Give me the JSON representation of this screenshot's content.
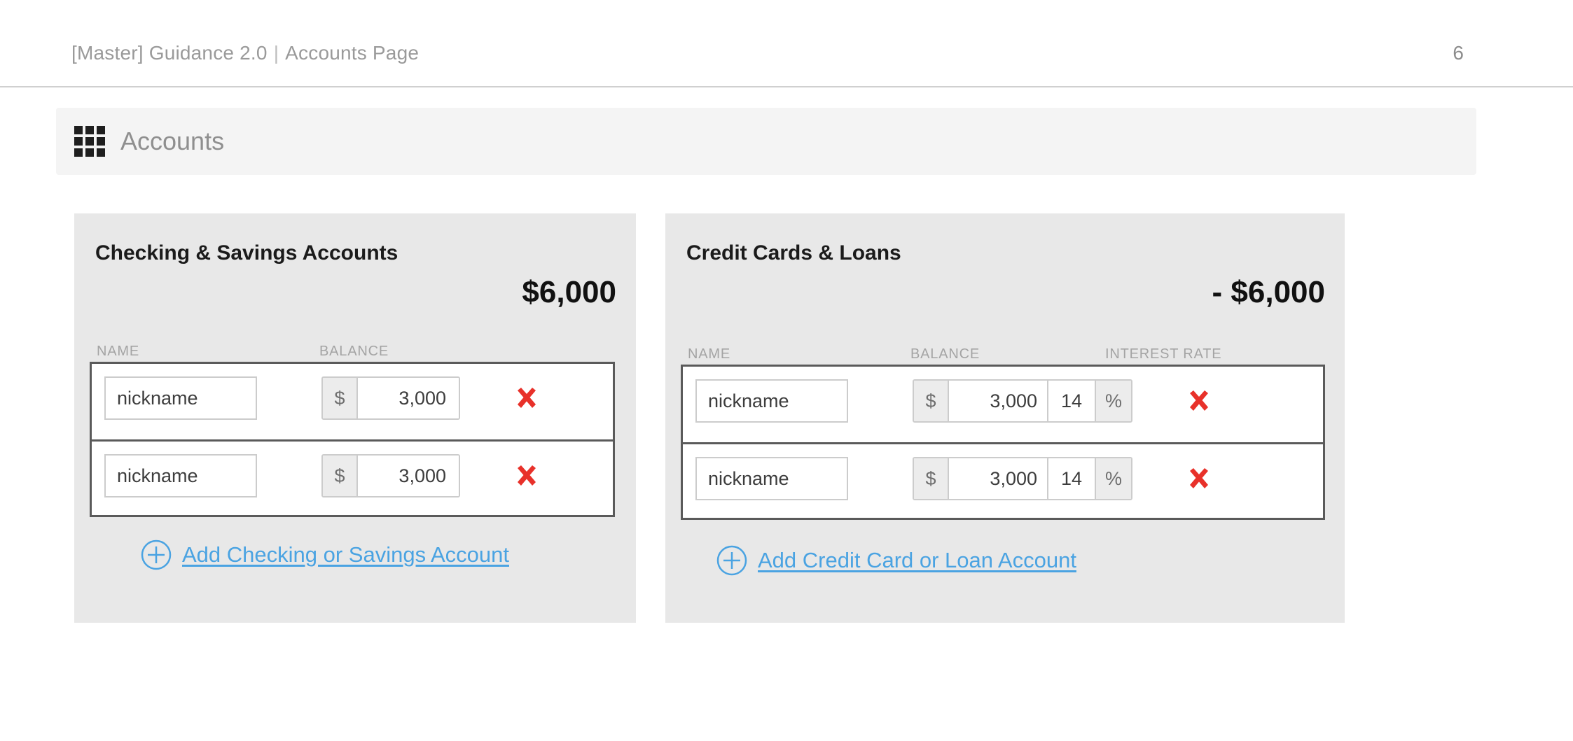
{
  "header": {
    "deck_title": "[Master] Guidance 2.0",
    "separator": "|",
    "page_title": "Accounts Page",
    "page_number": "6"
  },
  "section_bar": {
    "icon": "grid-icon",
    "title": "Accounts"
  },
  "colors": {
    "panel_background": "#e8e8e8",
    "section_bar_background": "#f4f4f4",
    "row_border": "#5a5a5a",
    "link_blue": "#4aa3e2",
    "delete_red": "#e8312a",
    "addon_gray": "#ececec",
    "muted_text": "#a4a4a4"
  },
  "panels": [
    {
      "id": "checking-savings",
      "title": "Checking & Savings Accounts",
      "total": "$6,000",
      "columns": [
        "NAME",
        "BALANCE"
      ],
      "rows": [
        {
          "name": "nickname",
          "balance_prefix": "$",
          "balance": "3,000",
          "delete_icon": "close-icon"
        },
        {
          "name": "nickname",
          "balance_prefix": "$",
          "balance": "3,000",
          "delete_icon": "close-icon"
        }
      ],
      "add_link": {
        "icon": "plus-circle-icon",
        "label": "Add Checking or Savings Account"
      }
    },
    {
      "id": "credit-loans",
      "title": "Credit Cards & Loans",
      "total": "- $6,000",
      "columns": [
        "NAME",
        "BALANCE",
        "INTEREST RATE"
      ],
      "rows": [
        {
          "name": "nickname",
          "balance_prefix": "$",
          "balance": "3,000",
          "rate": "14",
          "rate_suffix": "%",
          "delete_icon": "close-icon"
        },
        {
          "name": "nickname",
          "balance_prefix": "$",
          "balance": "3,000",
          "rate": "14",
          "rate_suffix": "%",
          "delete_icon": "close-icon"
        }
      ],
      "add_link": {
        "icon": "plus-circle-icon",
        "label": "Add Credit Card or Loan Account"
      }
    }
  ]
}
